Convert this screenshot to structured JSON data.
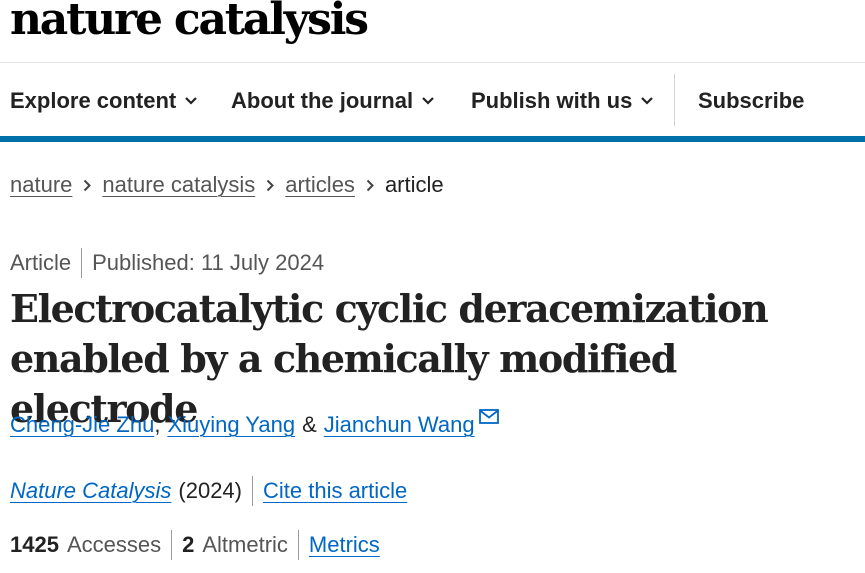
{
  "logo": {
    "text": "nature catalysis"
  },
  "nav": {
    "explore": "Explore content",
    "about": "About the journal",
    "publish": "Publish with us",
    "subscribe": "Subscribe"
  },
  "breadcrumb": [
    "nature",
    "nature catalysis",
    "articles",
    "article"
  ],
  "meta": {
    "type": "Article",
    "published": "Published: 11 July 2024"
  },
  "title": "Electrocatalytic cyclic deracemization enabled by a chemically modified electrode",
  "authors": {
    "a1": "Cheng-Jie Zhu",
    "sep1": ",",
    "a2": "Xiuying Yang",
    "amp": "&",
    "a3": "Jianchun Wang"
  },
  "citation": {
    "journal": "Nature Catalysis",
    "year": "(2024)",
    "cite": "Cite this article"
  },
  "metrics": {
    "accesses_count": "1425",
    "accesses_label": "Accesses",
    "altmetric_count": "2",
    "altmetric_label": "Altmetric",
    "link": "Metrics"
  },
  "colors": {
    "accent_bar": "#0070a8",
    "link": "#0067c5"
  },
  "icons": {
    "nav_dropdown": "chevron-down-icon",
    "breadcrumb_separator": "chevron-right-icon",
    "author_contact": "envelope-icon"
  }
}
